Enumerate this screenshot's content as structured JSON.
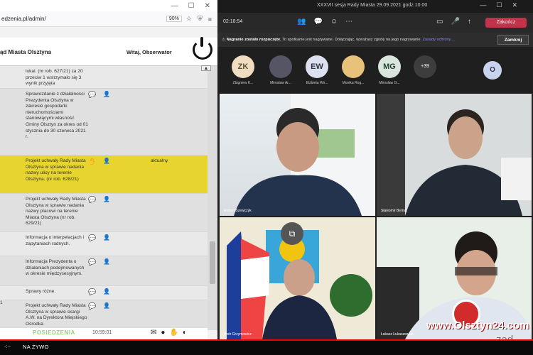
{
  "browser": {
    "url": "edzenia.pl/admin/",
    "zoom": "90%",
    "app_title": "ąd Miasta Olsztyna",
    "welcome": "Witaj, Obserwator",
    "scroll_up": "▲",
    "rows": [
      {
        "text": "lokal. (nr rob. 627/21) za 20 przeciw 1 wstrzymało się 3 wynik przyjęta",
        "status": "",
        "num": "",
        "icons": false
      },
      {
        "text": "Sprawozdanie z działalności Prezydenta Olsztyna w zakresie gospodarki nieruchomościami stanowiącymi własność Gminy Olsztyn za okres od 01 stycznia do 30 czerwca 2021 r.",
        "status": "",
        "num": "",
        "icons": true
      },
      {
        "text": "Projekt uchwały Rady Miasta Olsztyna w sprawie nadania nazwy ulicy na terenie Olsztyna. (nr rob. 628/21)",
        "status": "aktualny",
        "num": "",
        "icons": true
      },
      {
        "text": "Projekt uchwały Rady Miasta Olsztyna w sprawie nadania nazwy placowi na terenie Miasta Olsztyna (nr rob. 629/21)",
        "status": "",
        "num": "",
        "icons": true
      },
      {
        "text": "Informacja o interpelacjach i zapytaniach radnych.",
        "status": "",
        "num": "",
        "icons": true
      },
      {
        "text": "Informacja Prezydenta o działaniach podejmowanych w okresie międzysesyjnym.",
        "status": "",
        "num": "",
        "icons": true
      },
      {
        "text": "Sprawy różne.",
        "status": "",
        "num": "",
        "icons": true
      },
      {
        "text": "Projekt uchwały Rady Miasta Olsztyna w sprawie skargi A.W. na Dyrektora Miejskiego Ośrodka",
        "status": "",
        "num": "1",
        "icons": true
      }
    ],
    "footer_logo": "POSIEDZENIA",
    "footer_time": "10:59:01"
  },
  "teams": {
    "window_title": "XXXVII sesja Rady Miasta 29.09.2021 godz.10.00",
    "timer": "02:18:54",
    "leave_label": "Zakończ",
    "banner_bold": "Nagranie zostało rozpoczęte.",
    "banner_text": "To spotkanie jest nagrywane. Dołączając, wyrażasz zgodę na jego nagrywanie.",
    "banner_link": "Zasady ochrony ...",
    "banner_close": "Zamknij",
    "attendees": [
      {
        "initials": "ZK",
        "name": "Zbigniew K...",
        "color": "#f0dcc0",
        "fg": "#553"
      },
      {
        "initials": "",
        "name": "Mirosław Ar...",
        "color": "#556",
        "fg": "#fff"
      },
      {
        "initials": "EW",
        "name": "Elżbieta Wir...",
        "color": "#dde0f0",
        "fg": "#334"
      },
      {
        "initials": "",
        "name": "Monika Rog...",
        "color": "#e8c27a",
        "fg": "#fff"
      },
      {
        "initials": "MG",
        "name": "Mirosław G...",
        "color": "#d8e6de",
        "fg": "#243"
      }
    ],
    "more": "+39",
    "self_avatar": "O",
    "tiles": [
      {
        "name": "Robert Szewczyk"
      },
      {
        "name": "Sławomir Bernat"
      },
      {
        "name": "Piotr Grzymowicz"
      },
      {
        "name": "Łukasz Łukaszewski"
      }
    ],
    "popout_icon": "⧉"
  },
  "watermark": "www.Olsztyn24.com",
  "watermark2": "ząd",
  "player": {
    "time": "-:--",
    "live": "NA ŻYWO"
  }
}
